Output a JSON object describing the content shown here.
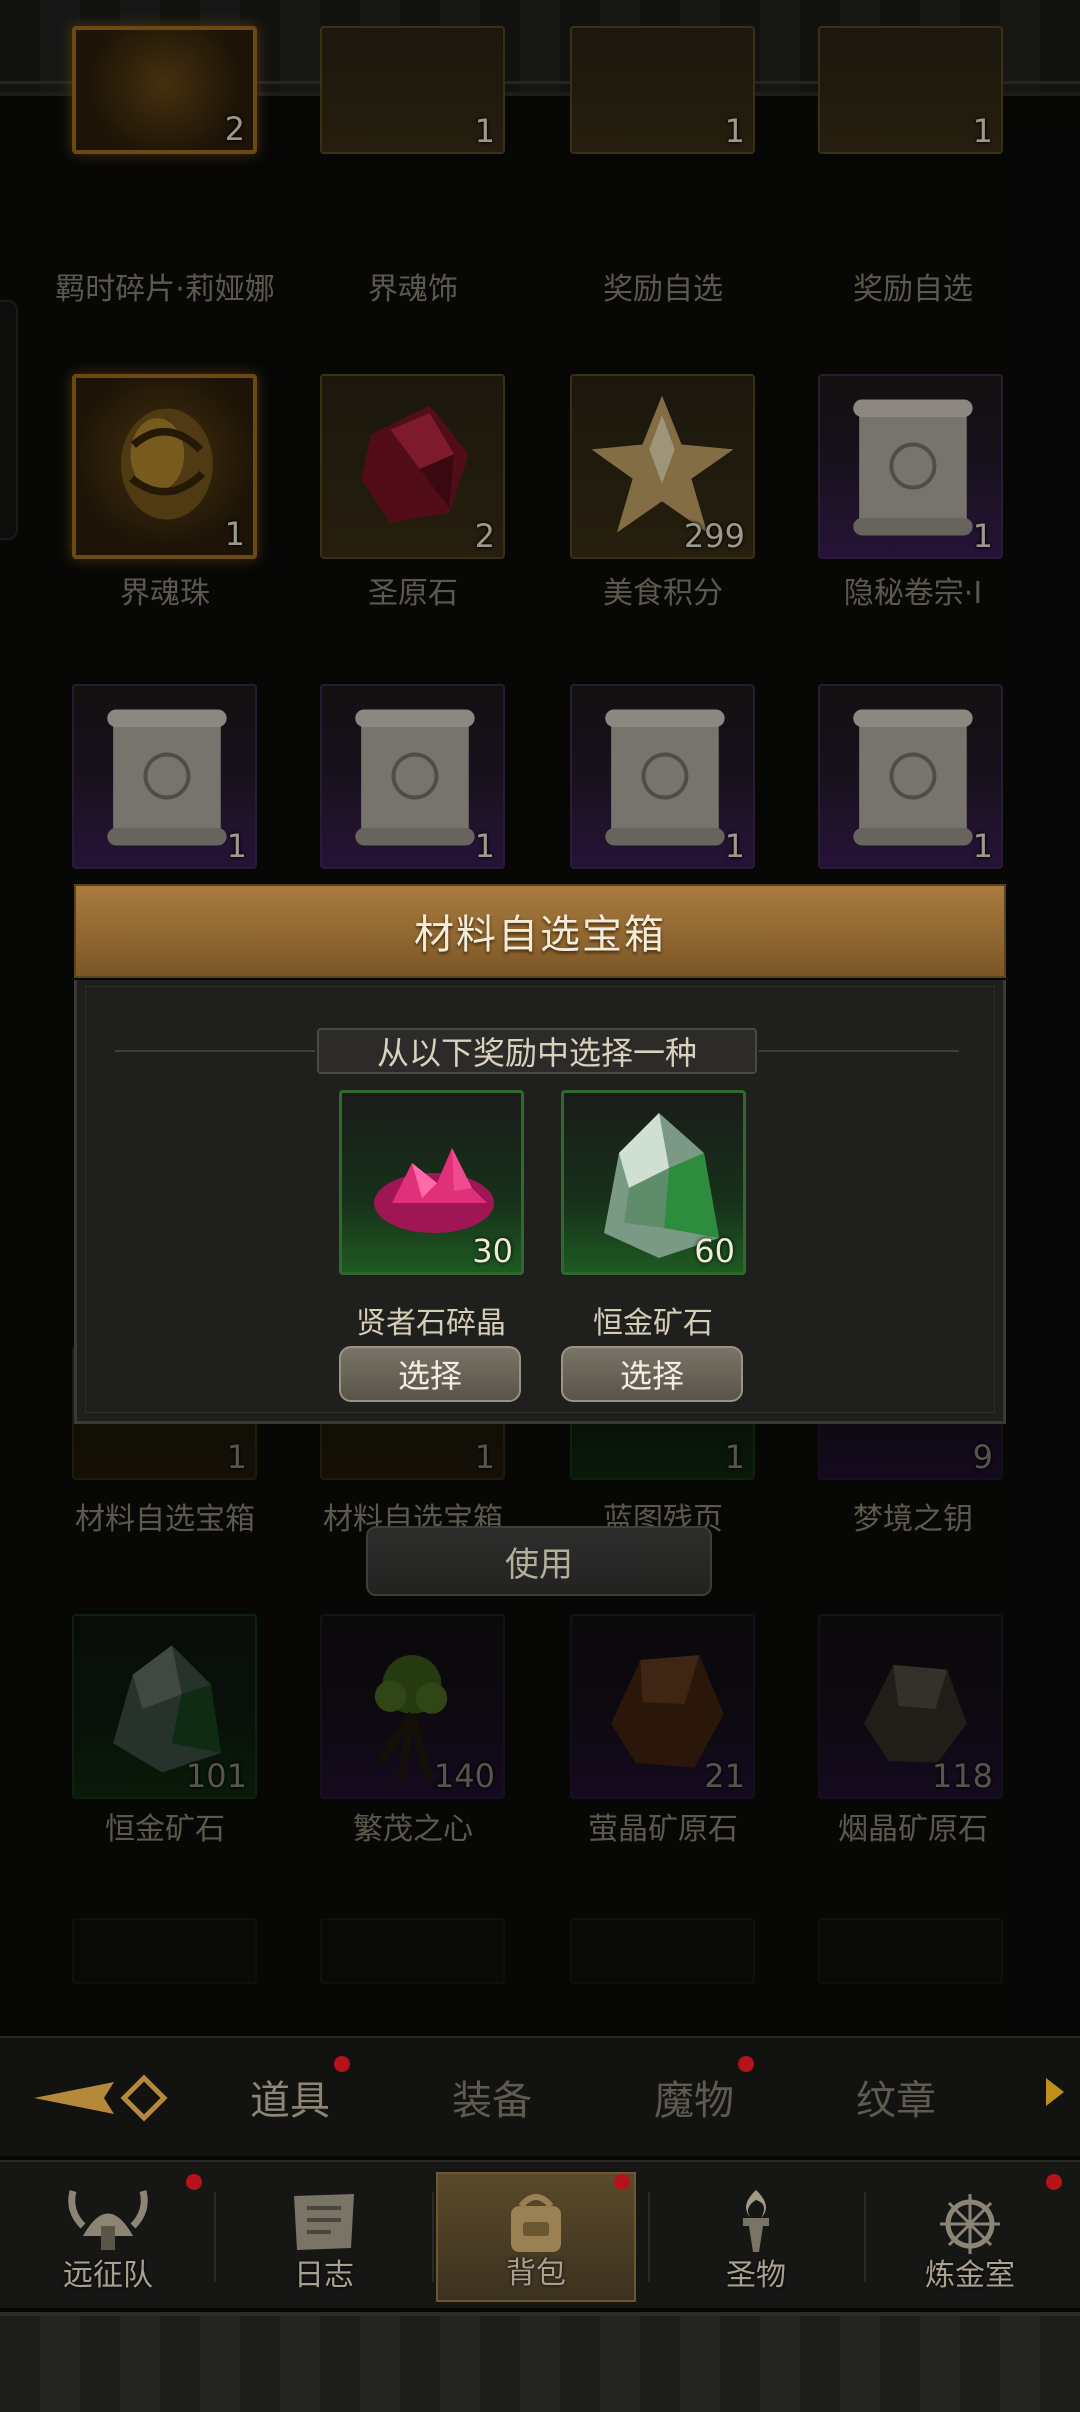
{
  "inventory": {
    "row1": [
      {
        "name": "羁时碎片·莉娅娜",
        "count": "2"
      },
      {
        "name": "界魂饰",
        "count": "1"
      },
      {
        "name": "奖励自选",
        "count": "1"
      },
      {
        "name": "奖励自选",
        "count": "1"
      }
    ],
    "row2": [
      {
        "name": "界魂珠",
        "count": "1"
      },
      {
        "name": "圣原石",
        "count": "2"
      },
      {
        "name": "美食积分",
        "count": "299"
      },
      {
        "name": "隐秘卷宗·I",
        "count": "1"
      }
    ],
    "row3": [
      {
        "name": "",
        "count": "1"
      },
      {
        "name": "",
        "count": "1"
      },
      {
        "name": "",
        "count": "1"
      },
      {
        "name": "",
        "count": "1"
      }
    ],
    "row4": [
      {
        "name": "材料自选宝箱",
        "count": "1"
      },
      {
        "name": "材料自选宝箱",
        "count": "1"
      },
      {
        "name": "蓝图残页",
        "count": "1"
      },
      {
        "name": "梦境之钥",
        "count": "9"
      }
    ],
    "row5": [
      {
        "name": "恒金矿石",
        "count": "101"
      },
      {
        "name": "繁茂之心",
        "count": "140"
      },
      {
        "name": "萤晶矿原石",
        "count": "21"
      },
      {
        "name": "烟晶矿原石",
        "count": "118"
      }
    ]
  },
  "modal": {
    "title": "材料自选宝箱",
    "subtitle": "从以下奖励中选择一种",
    "rewards": [
      {
        "name": "贤者石碎晶",
        "count": "30",
        "button": "选择"
      },
      {
        "name": "恒金矿石",
        "count": "60",
        "button": "选择"
      }
    ]
  },
  "use_button": "使用",
  "tabs": [
    {
      "label": "道具",
      "badge": true
    },
    {
      "label": "装备",
      "badge": false
    },
    {
      "label": "魔物",
      "badge": true
    },
    {
      "label": "纹章",
      "badge": false
    }
  ],
  "bottom_nav": [
    {
      "label": "远征队",
      "icon": "viking-helmet-icon",
      "badge": true
    },
    {
      "label": "日志",
      "icon": "journal-icon",
      "badge": false
    },
    {
      "label": "背包",
      "icon": "backpack-icon",
      "badge": true
    },
    {
      "label": "圣物",
      "icon": "torch-icon",
      "badge": false
    },
    {
      "label": "炼金室",
      "icon": "alchemy-icon",
      "badge": true
    }
  ],
  "colors": {
    "accent_gold": "#a87c40",
    "badge_red": "#b5121a",
    "rarity_purple": "#3b1d55",
    "rarity_green": "#1e5a21",
    "rarity_legendary": "#a5701c"
  }
}
